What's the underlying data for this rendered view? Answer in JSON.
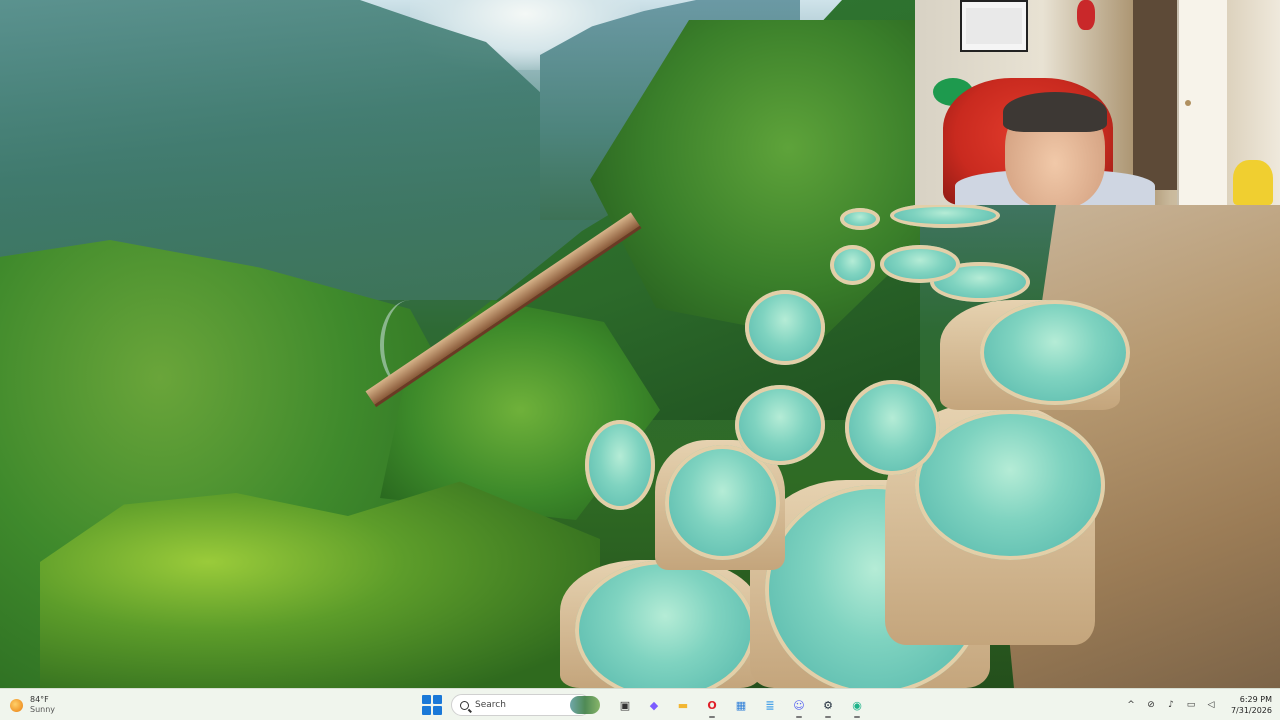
{
  "taskbar": {
    "weather": {
      "temperature": "84°F",
      "condition": "Sunny",
      "icon": "sun-icon"
    },
    "search": {
      "placeholder": "Search"
    },
    "apps": [
      {
        "name": "task-view",
        "icon": "task-view-icon",
        "color": "#333333",
        "glyph": "▣"
      },
      {
        "name": "copilot",
        "icon": "copilot-icon",
        "color": "#7b5cff",
        "glyph": "◆"
      },
      {
        "name": "file-explorer",
        "icon": "folder-icon",
        "color": "#f2b632",
        "glyph": "▬"
      },
      {
        "name": "opera",
        "icon": "opera-icon",
        "color": "#e0202a",
        "glyph": "O"
      },
      {
        "name": "photos",
        "icon": "photos-icon",
        "color": "#2f7fd8",
        "glyph": "▦"
      },
      {
        "name": "notepad",
        "icon": "notepad-icon",
        "color": "#4aa3e8",
        "glyph": "≣"
      },
      {
        "name": "discord",
        "icon": "discord-icon",
        "color": "#5865f2",
        "glyph": "☺"
      },
      {
        "name": "steam",
        "icon": "steam-icon",
        "color": "#1b2838",
        "glyph": "⚙"
      },
      {
        "name": "obs-or-recorder",
        "icon": "recorder-icon",
        "color": "#1fb38a",
        "glyph": "◉"
      }
    ],
    "tray": {
      "chevron": "^",
      "clock_time": "6:29 PM",
      "clock_date": "7/31/2026"
    }
  }
}
